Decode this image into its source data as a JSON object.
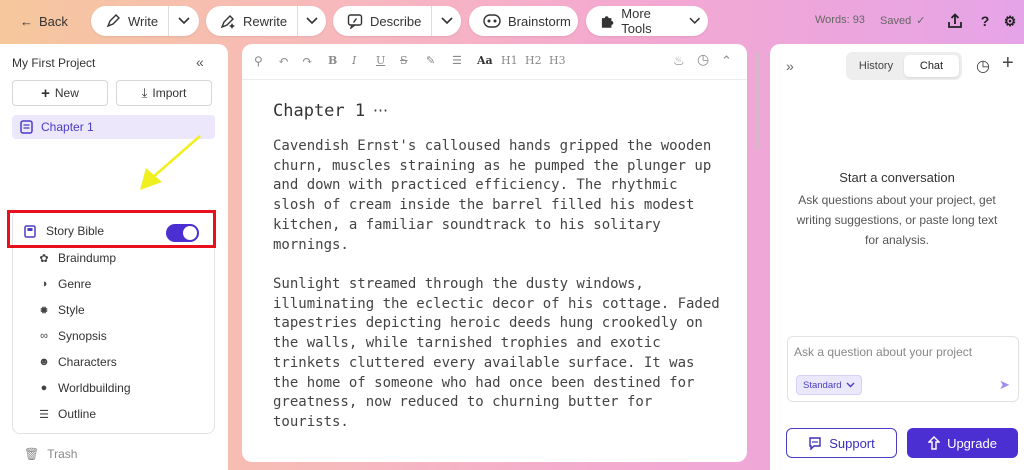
{
  "topbar": {
    "back_label": "Back",
    "write_label": "Write",
    "rewrite_label": "Rewrite",
    "describe_label": "Describe",
    "brainstorm_label": "Brainstorm",
    "more_tools_label": "More Tools",
    "words_label": "Words: 93",
    "saved_label": "Saved"
  },
  "sidebar": {
    "project_title": "My First Project",
    "new_label": "New",
    "import_label": "Import",
    "chapter_label": "Chapter 1",
    "story_bible_label": "Story Bible",
    "story_bible_enabled": true,
    "items": [
      {
        "label": "Braindump",
        "icon": "brain-icon"
      },
      {
        "label": "Genre",
        "icon": "genre-icon"
      },
      {
        "label": "Style",
        "icon": "style-icon"
      },
      {
        "label": "Synopsis",
        "icon": "synopsis-icon"
      },
      {
        "label": "Characters",
        "icon": "characters-icon"
      },
      {
        "label": "Worldbuilding",
        "icon": "globe-icon"
      },
      {
        "label": "Outline",
        "icon": "outline-icon"
      }
    ],
    "trash_label": "Trash"
  },
  "editor": {
    "chapter_title": "Chapter 1",
    "paragraphs": [
      "Cavendish Ernst's calloused hands gripped the wooden churn, muscles straining as he pumped the plunger up and down with practiced efficiency. The rhythmic slosh of cream inside the barrel filled his modest kitchen, a familiar soundtrack to his solitary mornings.",
      "Sunlight streamed through the dusty windows, illuminating the eclectic decor of his cottage. Faded tapestries depicting heroic deeds hung crookedly on the walls, while tarnished trophies and exotic trinkets cluttered every available surface. It was the home of someone who had once been destined for greatness, now reduced to churning butter for tourists."
    ],
    "toolbar": {
      "aa": "Aa",
      "h1": "H1",
      "h2": "H2",
      "h3": "H3",
      "bold": "B",
      "italic": "I",
      "underline": "U",
      "strike": "S"
    }
  },
  "chat": {
    "tab_history": "History",
    "tab_chat": "Chat",
    "active_tab": "Chat",
    "empty_title": "Start a conversation",
    "empty_desc": "Ask questions about your project, get writing suggestions, or paste long text for analysis.",
    "input_placeholder": "Ask a question about your project",
    "mode_label": "Standard",
    "support_label": "Support",
    "upgrade_label": "Upgrade"
  },
  "colors": {
    "accent": "#4b2fd3",
    "highlight_box": "#e8101a",
    "annotation_arrow": "#f0f020"
  }
}
